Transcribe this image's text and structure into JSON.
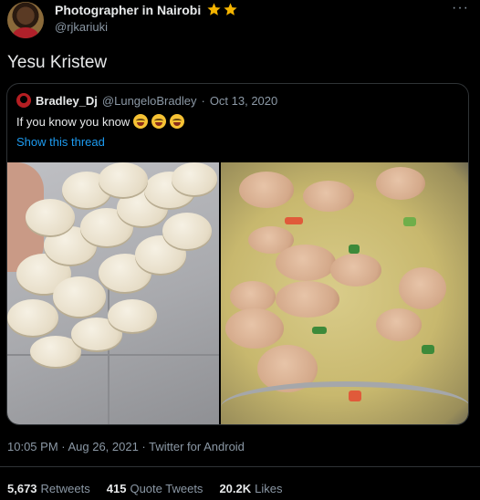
{
  "author": {
    "display_name": "Photographer in Nairobi",
    "handle": "@rjkariuki",
    "badges": [
      "star-icon",
      "star-icon"
    ]
  },
  "tweet": {
    "text": "Yesu Kristew"
  },
  "quoted": {
    "name": "Bradley_Dj",
    "handle": "@LungeloBradley",
    "separator": "·",
    "date": "Oct 13, 2020",
    "text": "If you know you know",
    "emoji_count": 3,
    "show_thread": "Show this thread",
    "media": [
      "stack-of-communion-wafers-image",
      "sausage-soup-image"
    ]
  },
  "meta": {
    "time": "10:05 PM · Aug 26, 2021 · Twitter for Android"
  },
  "stats": {
    "retweets_count": "5,673",
    "retweets_label": "Retweets",
    "quotes_count": "415",
    "quotes_label": "Quote Tweets",
    "likes_count": "20.2K",
    "likes_label": "Likes"
  },
  "colors": {
    "background": "#000000",
    "text": "#e7e9ea",
    "muted": "#8b98a5",
    "link": "#1d9bf0",
    "star": "#f4b400"
  }
}
